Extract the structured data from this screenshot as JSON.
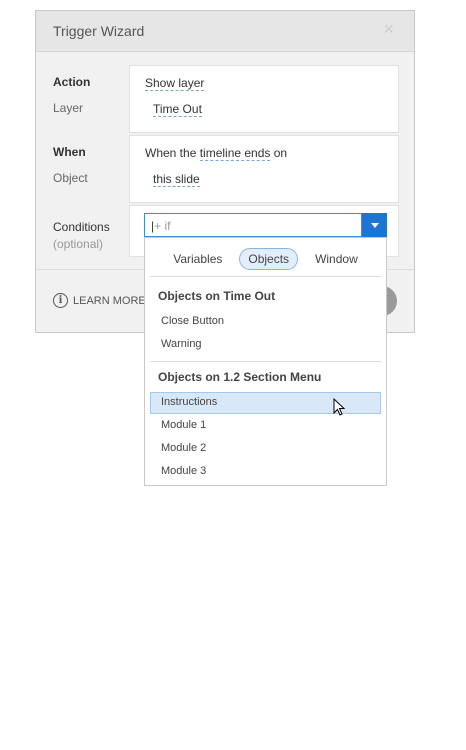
{
  "dialog": {
    "title": "Trigger Wizard",
    "close_glyph": "×"
  },
  "action": {
    "label": "Action",
    "sub_label": "Layer",
    "value": "Show layer",
    "sub_value": "Time Out"
  },
  "when": {
    "label": "When",
    "sub_label": "Object",
    "prefix": "When the ",
    "link": "timeline ends",
    "suffix": " on",
    "sub_value": "this slide"
  },
  "conditions": {
    "label": "Conditions",
    "sub_label": "(optional)",
    "input_value": "+ if"
  },
  "footer": {
    "learn_more": "LEARN MORE",
    "info_glyph": "i"
  },
  "dropdown": {
    "tabs": [
      {
        "label": "Variables",
        "active": false
      },
      {
        "label": "Objects",
        "active": true
      },
      {
        "label": "Window",
        "active": false
      }
    ],
    "groups": [
      {
        "title": "Objects on Time Out",
        "items": [
          "Close Button",
          "Warning"
        ]
      },
      {
        "title": "Objects on 1.2 Section Menu",
        "items": [
          "Instructions",
          "Module 1",
          "Module 2",
          "Module 3"
        ]
      }
    ],
    "hovered_item": "Instructions"
  },
  "colors": {
    "accent": "#1d74d3",
    "hover_bg": "#d8e8f6"
  }
}
